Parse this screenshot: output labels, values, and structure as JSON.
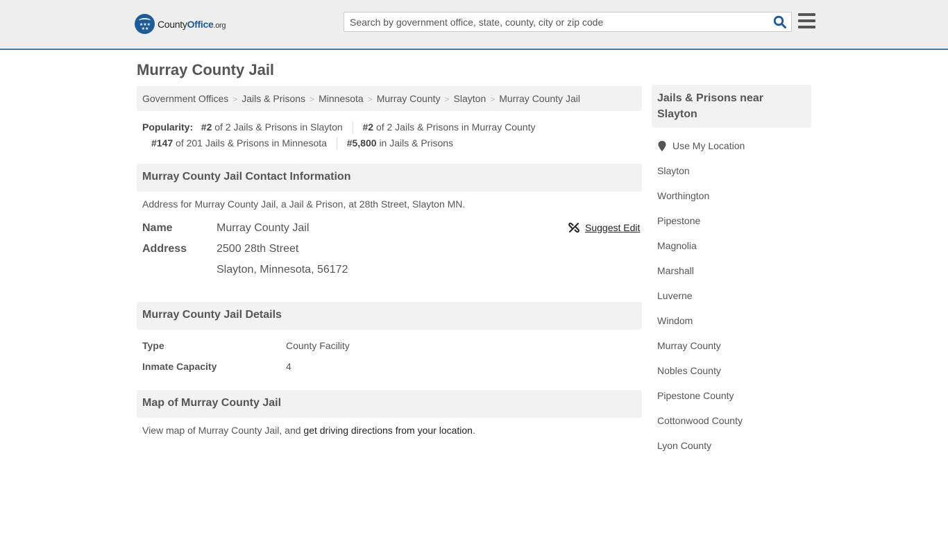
{
  "header": {
    "logo": {
      "part1": "County",
      "part2": "Office",
      "part3": ".org"
    },
    "search": {
      "placeholder": "Search by government office, state, county, city or zip code",
      "value": ""
    },
    "icons": {
      "search": "search-icon",
      "menu": "hamburger-menu-icon"
    }
  },
  "page": {
    "title": "Murray County Jail",
    "breadcrumb": [
      "Government Offices",
      "Jails & Prisons",
      "Minnesota",
      "Murray County",
      "Slayton",
      "Murray County Jail"
    ],
    "breadcrumb_separator": ">",
    "popularity": {
      "label": "Popularity:",
      "items": [
        {
          "rank": "#2",
          "text": "of 2 Jails & Prisons in Slayton"
        },
        {
          "rank": "#2",
          "text": "of 2 Jails & Prisons in Murray County"
        },
        {
          "rank": "#147",
          "text": "of 201 Jails & Prisons in Minnesota"
        },
        {
          "rank": "#5,800",
          "text": "in Jails & Prisons"
        }
      ]
    }
  },
  "contact": {
    "heading": "Murray County Jail Contact Information",
    "intro": "Address for Murray County Jail, a Jail & Prison, at 28th Street, Slayton MN.",
    "suggest_edit": "Suggest Edit",
    "name_label": "Name",
    "name_value": "Murray County Jail",
    "address_label": "Address",
    "address_line1": "2500 28th Street",
    "address_line2": "Slayton, Minnesota, 56172"
  },
  "details": {
    "heading": "Murray County Jail Details",
    "rows": [
      {
        "label": "Type",
        "value": "County Facility"
      },
      {
        "label": "Inmate Capacity",
        "value": "4"
      }
    ]
  },
  "map": {
    "heading": "Map of Murray County Jail",
    "text_before": "View map of Murray County Jail, and ",
    "link": "get driving directions from your location",
    "text_after": "."
  },
  "sidebar": {
    "heading": "Jails & Prisons near Slayton",
    "use_location": "Use My Location",
    "items": [
      "Slayton",
      "Worthington",
      "Pipestone",
      "Magnolia",
      "Marshall",
      "Luverne",
      "Windom",
      "Murray County",
      "Nobles County",
      "Pipestone County",
      "Cottonwood County",
      "Lyon County"
    ]
  },
  "colors": {
    "brand": "#1d5b99",
    "header_border": "#3c7fb1",
    "panel_bg": "#f2f2f2"
  }
}
